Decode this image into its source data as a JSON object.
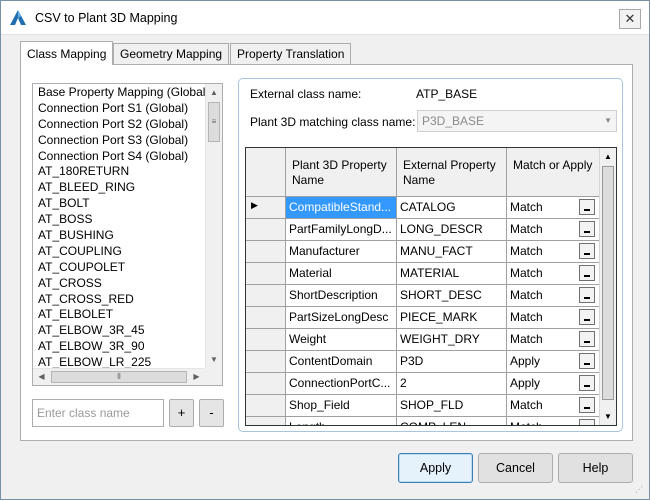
{
  "window": {
    "title": "CSV to Plant 3D Mapping",
    "close_glyph": "✕",
    "icon": "autocad-a-icon"
  },
  "tabs": [
    {
      "label": "Class Mapping",
      "active": true
    },
    {
      "label": "Geometry Mapping",
      "active": false
    },
    {
      "label": "Property Translation",
      "active": false
    }
  ],
  "class_list": {
    "items": [
      "Base Property Mapping (Global)",
      "Connection Port S1 (Global)",
      "Connection Port S2 (Global)",
      "Connection Port S3 (Global)",
      "Connection Port S4 (Global)",
      "AT_180RETURN",
      "AT_BLEED_RING",
      "AT_BOLT",
      "AT_BOSS",
      "AT_BUSHING",
      "AT_COUPLING",
      "AT_COUPOLET",
      "AT_CROSS",
      "AT_CROSS_RED",
      "AT_ELBOLET",
      "AT_ELBOW_3R_45",
      "AT_ELBOW_3R_90",
      "AT_ELBOW_LR_225"
    ],
    "input_placeholder": "Enter class name",
    "add_label": "+",
    "remove_label": "-"
  },
  "mapping": {
    "external_class_label": "External class name:",
    "external_class_value": "ATP_BASE",
    "plant_class_label": "Plant 3D matching class name:",
    "plant_class_value": "P3D_BASE",
    "grid": {
      "headers": {
        "col1": "Plant 3D Property Name",
        "col2": "External Property Name",
        "col3": "Match or Apply"
      },
      "current_row_marker": "▶",
      "rows": [
        {
          "p3d": "CompatibleStand...",
          "ext": "CATALOG",
          "mode": "Match"
        },
        {
          "p3d": "PartFamilyLongD...",
          "ext": "LONG_DESCR",
          "mode": "Match"
        },
        {
          "p3d": "Manufacturer",
          "ext": "MANU_FACT",
          "mode": "Match"
        },
        {
          "p3d": "Material",
          "ext": "MATERIAL",
          "mode": "Match"
        },
        {
          "p3d": "ShortDescription",
          "ext": "SHORT_DESC",
          "mode": "Match"
        },
        {
          "p3d": "PartSizeLongDesc",
          "ext": "PIECE_MARK",
          "mode": "Match"
        },
        {
          "p3d": "Weight",
          "ext": "WEIGHT_DRY",
          "mode": "Match"
        },
        {
          "p3d": "ContentDomain",
          "ext": "P3D",
          "mode": "Apply"
        },
        {
          "p3d": "ConnectionPortC...",
          "ext": "2",
          "mode": "Apply"
        },
        {
          "p3d": "Shop_Field",
          "ext": "SHOP_FLD",
          "mode": "Match"
        },
        {
          "p3d": "Length",
          "ext": "COMP_LEN",
          "mode": "Match"
        }
      ]
    }
  },
  "buttons": {
    "apply": "Apply",
    "cancel": "Cancel",
    "help": "Help"
  },
  "colors": {
    "selection": "#3399ff",
    "panel_border": "#a9c4e0",
    "primary_button_border": "#3c7fb1"
  }
}
